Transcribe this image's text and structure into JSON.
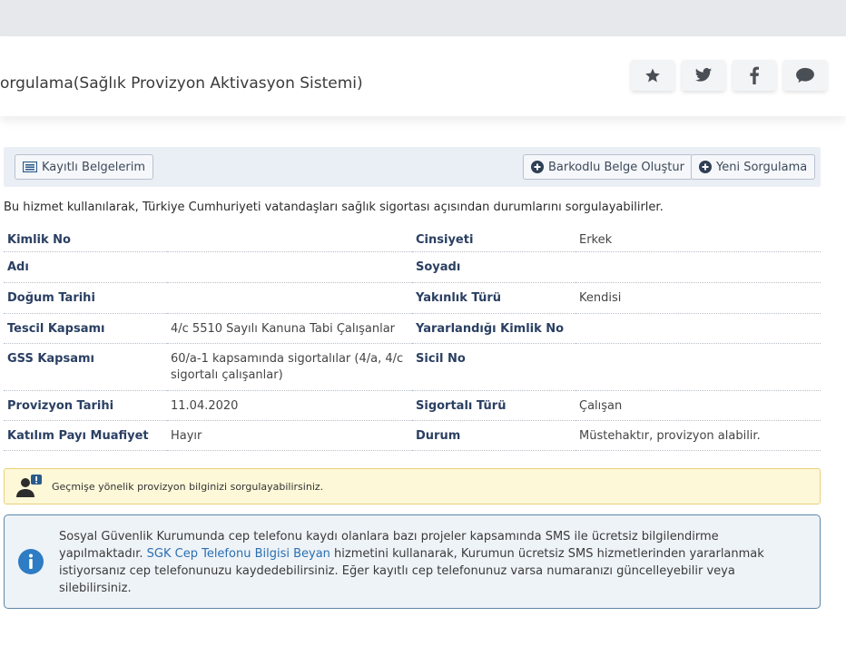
{
  "header": {
    "title": "orgulama(Sağlık Provizyon Aktivasyon Sistemi)",
    "social": [
      {
        "name": "star-icon"
      },
      {
        "name": "twitter-icon"
      },
      {
        "name": "facebook-icon"
      },
      {
        "name": "comment-icon"
      }
    ]
  },
  "toolbar": {
    "saved_docs_label": "Kayıtlı Belgelerim",
    "barcode_label": "Barkodlu Belge Oluştur",
    "new_query_label": "Yeni Sorgulama"
  },
  "intro": "Bu hizmet kullanılarak, Türkiye Cumhuriyeti vatandaşları sağlık sigortası açısından durumlarını sorgulayabilirler.",
  "table": {
    "rows": [
      {
        "l1": "Kimlik No",
        "v1": "",
        "l2": "Cinsiyeti",
        "v2": "Erkek"
      },
      {
        "l1": "Adı",
        "v1": "",
        "l2": "Soyadı",
        "v2": ""
      },
      {
        "l1": "Doğum Tarihi",
        "v1": "",
        "l2": "Yakınlık Türü",
        "v2": "Kendisi"
      },
      {
        "l1": "Tescil Kapsamı",
        "v1": "4/c 5510 Sayılı Kanuna Tabi Çalışanlar",
        "l2": "Yararlandığı Kimlik No",
        "v2": ""
      },
      {
        "l1": "GSS Kapsamı",
        "v1": "60/a-1 kapsamında sigortalılar (4/a, 4/c sigortalı çalışanlar)",
        "l2": "Sicil No",
        "v2": ""
      },
      {
        "l1": "Provizyon Tarihi",
        "v1": "11.04.2020",
        "l2": "Sigortalı Türü",
        "v2": "Çalışan"
      },
      {
        "l1": "Katılım Payı Muafiyet",
        "v1": "Hayır",
        "l2": "Durum",
        "v2": "Müstehaktır, provizyon alabilir."
      }
    ]
  },
  "warning": {
    "text": "Geçmişe yönelik provizyon bilginizi sorgulayabilirsiniz."
  },
  "notice": {
    "text_before": "Sosyal Güvenlik Kurumunda cep telefonu kaydı olanlara bazı projeler kapsamında SMS ile ücretsiz bilgilendirme yapılmaktadır. ",
    "link": "SGK Cep Telefonu Bilgisi Beyan",
    "text_after": " hizmetini kullanarak, Kurumun ücretsiz SMS hizmetlerinden yararlanmak istiyorsanız cep telefonunuzu kaydedebilirsiniz. Eğer kayıtlı cep telefonunuz varsa numaranızı güncelleyebilir veya silebilirsiniz."
  },
  "colors": {
    "label": "#2a3f62",
    "link": "#2a6fb0",
    "warning_bg": "#fdf8d8",
    "notice_border": "#5d87a8",
    "info_icon": "#2d7cc4"
  }
}
